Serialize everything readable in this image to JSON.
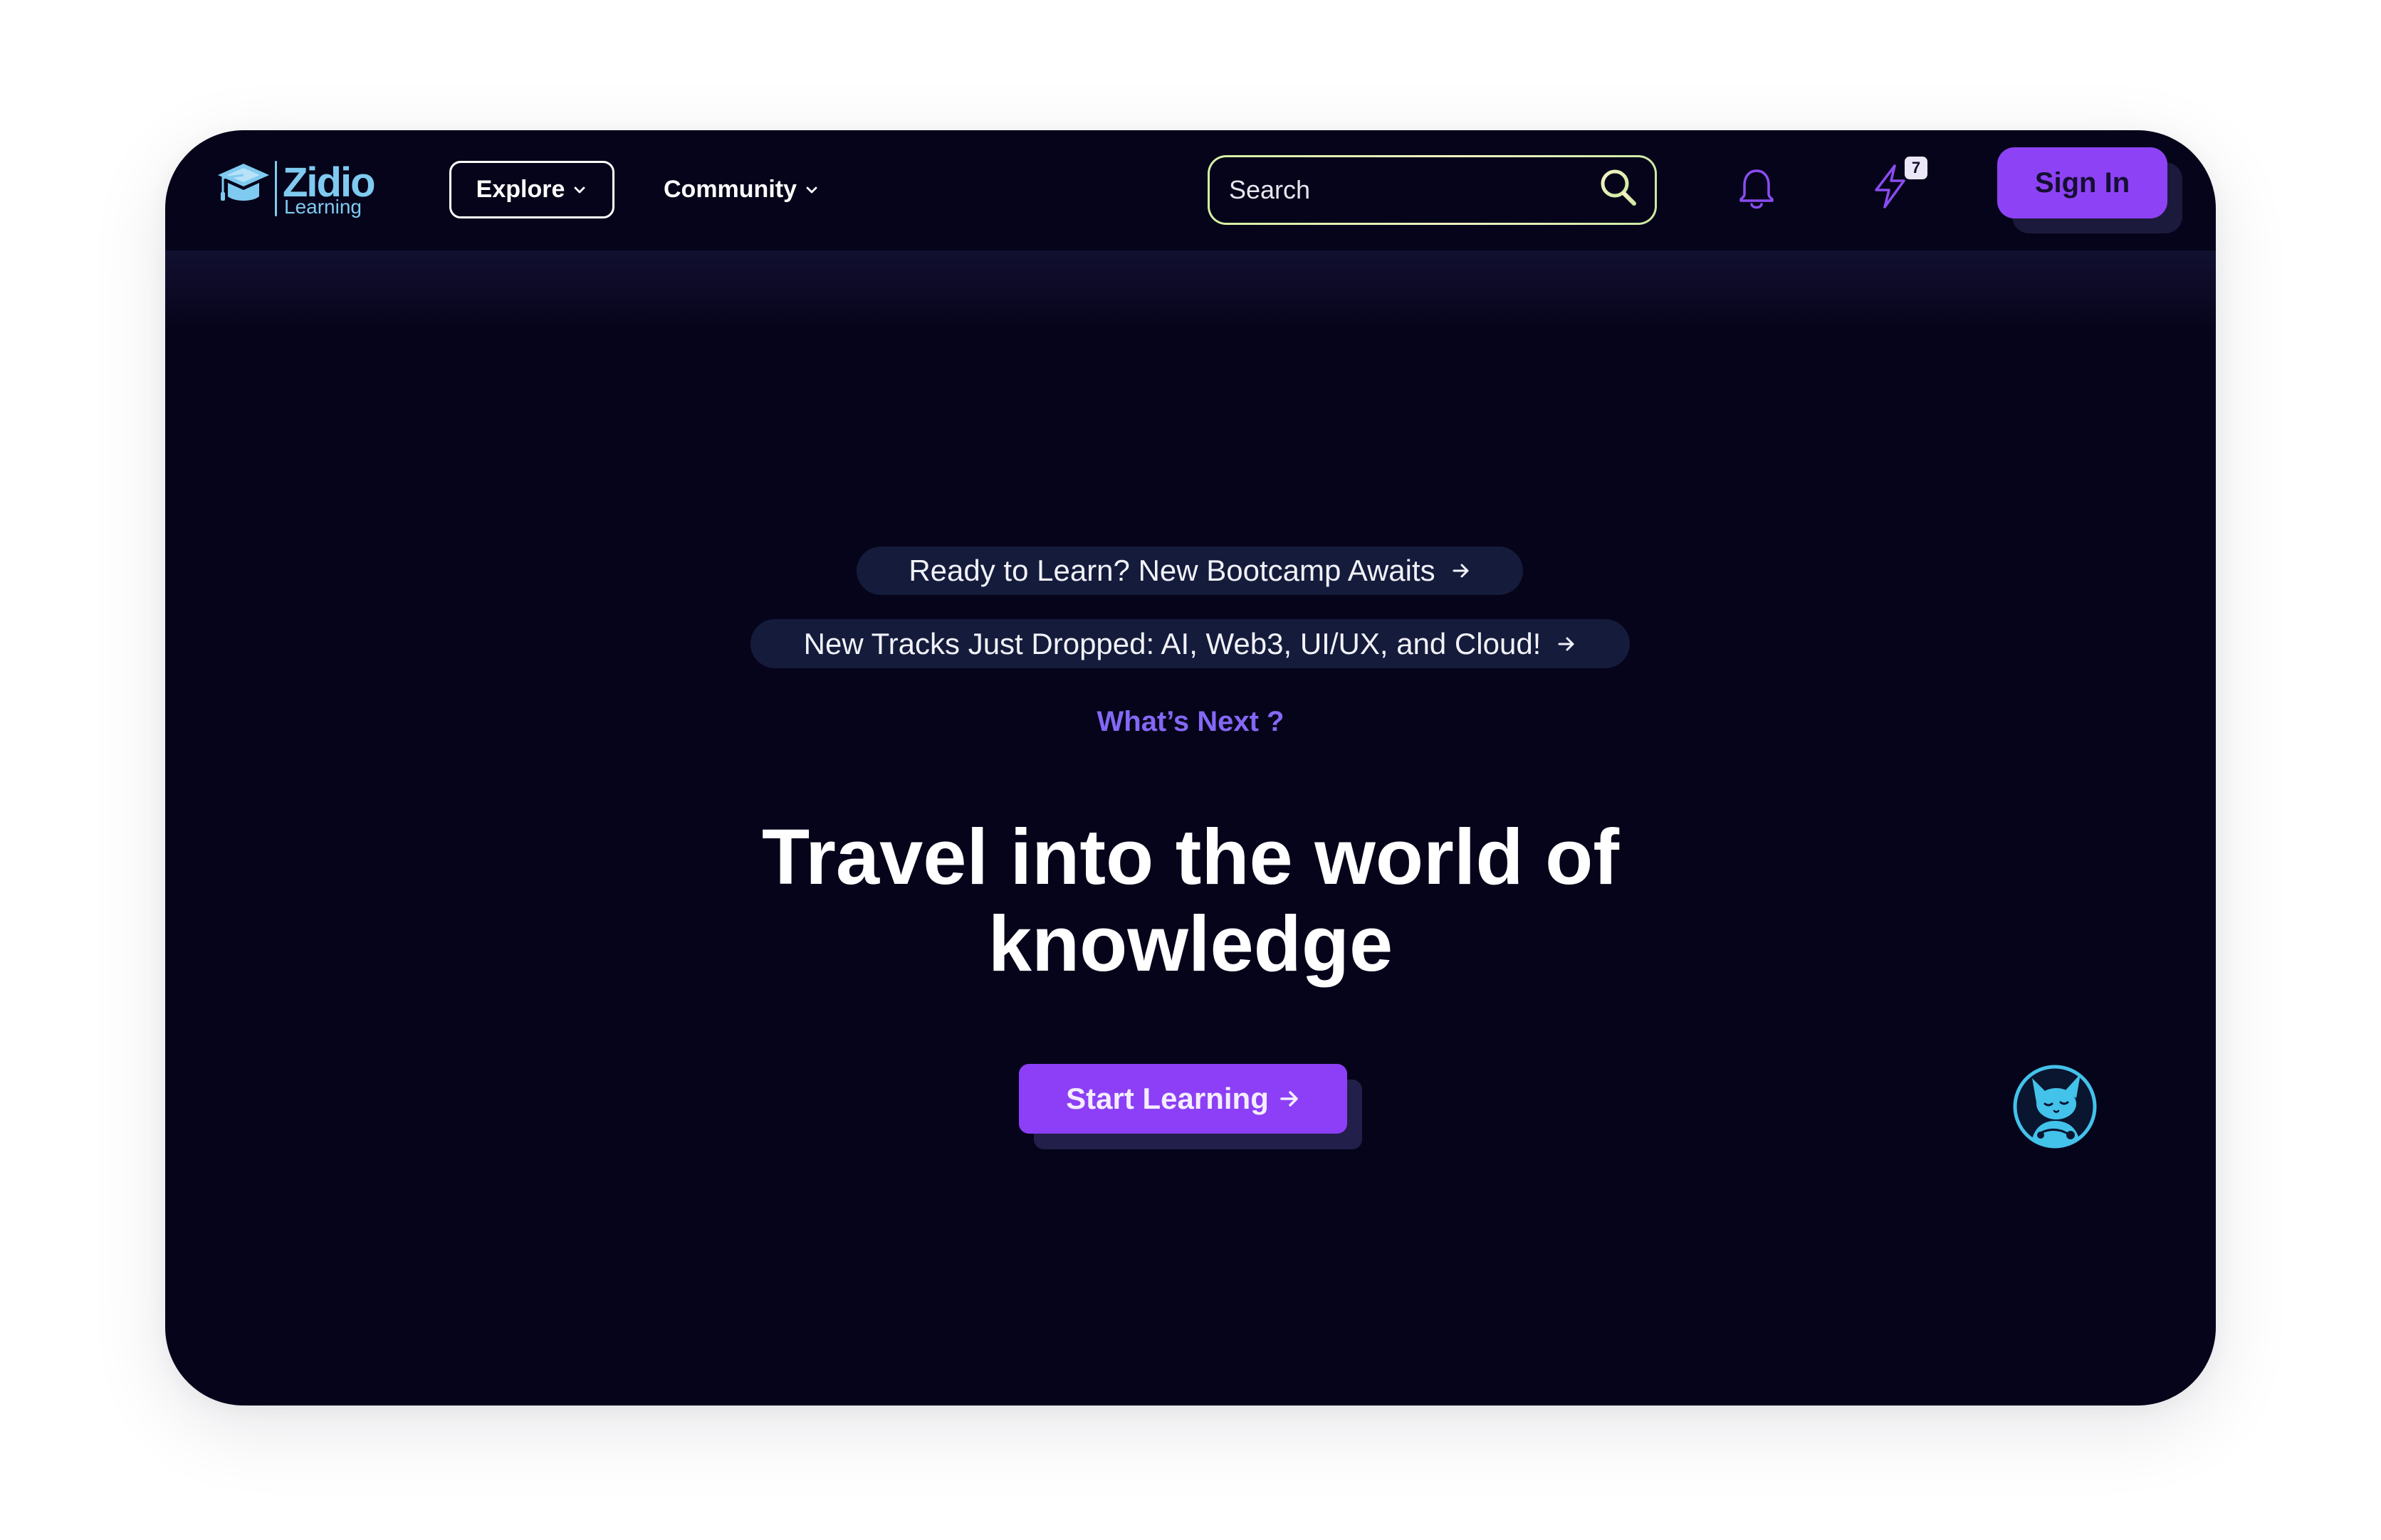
{
  "brand": {
    "name": "Zidio",
    "subtitle": "Learning",
    "logo_icon": "graduation-cap-icon"
  },
  "nav": {
    "explore": {
      "label": "Explore",
      "icon": "chevron-down-icon"
    },
    "community": {
      "label": "Community",
      "icon": "chevron-down-icon"
    },
    "search": {
      "placeholder": "Search",
      "value": "",
      "icon": "search-icon"
    },
    "notifications": {
      "icon": "bell-icon"
    },
    "streak": {
      "icon": "lightning-bolt-icon",
      "badge": "7"
    },
    "sign_in": {
      "label": "Sign In"
    }
  },
  "hero": {
    "announcements": [
      {
        "text": "Ready to Learn? New Bootcamp Awaits",
        "icon": "arrow-right-icon"
      },
      {
        "text": "New Tracks Just Dropped: AI, Web3, UI/UX, and Cloud!",
        "icon": "arrow-right-icon"
      }
    ],
    "eyebrow": "What’s Next ?",
    "headline": [
      "Travel into the world of",
      "knowledge"
    ],
    "cta": {
      "label": "Start Learning",
      "icon": "arrow-right-icon"
    }
  },
  "assistant": {
    "icon": "mascot-avatar-icon"
  },
  "colors": {
    "page_background": "#ffffff",
    "card_background": "#06041a",
    "accent_purple": "#8c3ff6",
    "button_shadow": "#221f4a",
    "pill_background": "#151b3b",
    "eyebrow_text": "#8468f5",
    "brand_blue": "#7fcaf0",
    "icon_purple": "#8a4cf0",
    "search_border": "#dcf0a4",
    "mascot_cyan": "#43c2ea"
  }
}
